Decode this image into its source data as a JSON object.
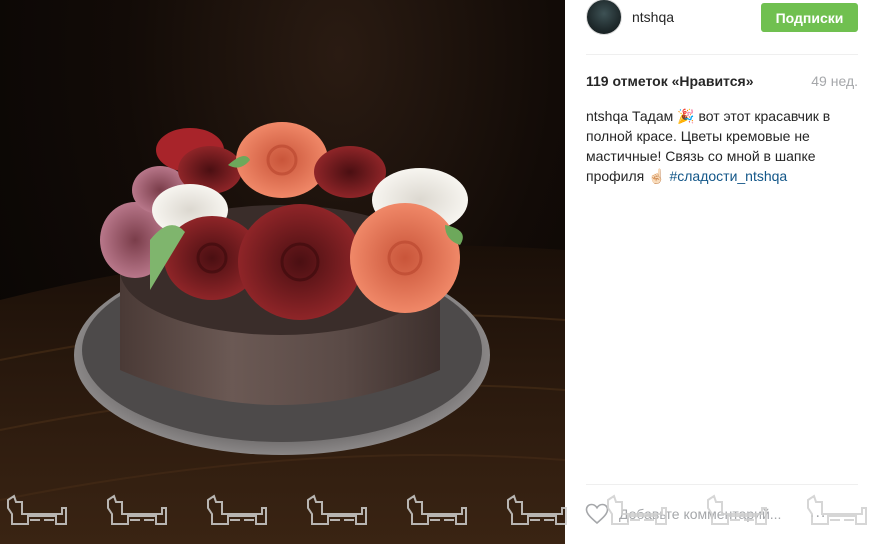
{
  "post": {
    "photo_alt": "",
    "user": {
      "username": "ntshqa"
    },
    "follow_button_label": "Подписки",
    "likes_text": "119 отметок «Нравится»",
    "timestamp": "49 нед.",
    "caption": {
      "author": "ntshqa",
      "text_part1": "Тадам ",
      "emoji1": "🎉",
      "text_part2": " вот этот красавчик в полной красе. Цветы кремовые не мастичные! Связь со мной в шапке профиля ",
      "emoji2": "☝🏻",
      "hashtag": "#сладости_ntshqa"
    },
    "comment_placeholder": "Добавьте комментарий...",
    "more_label": "..."
  },
  "colors": {
    "follow_button": "#70c050",
    "hashtag": "#125688",
    "muted_text": "#a5a7aa",
    "divider": "#efefef"
  },
  "icons": [
    "heart-icon",
    "more-options-icon",
    "avatar",
    "watermark-logo"
  ]
}
